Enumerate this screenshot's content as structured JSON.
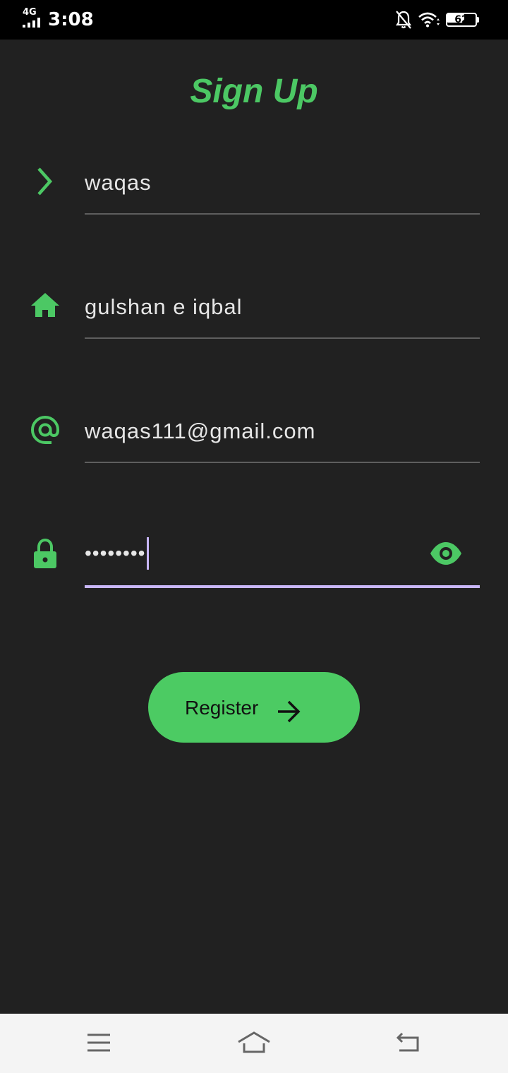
{
  "status_bar": {
    "network_type": "4G",
    "time": "3:08",
    "battery_level": "62",
    "icons": [
      "signal-bars-icon",
      "bell-off-icon",
      "wifi-icon",
      "battery-icon"
    ]
  },
  "page": {
    "title": "Sign Up"
  },
  "form": {
    "name": {
      "value": "waqas",
      "icon": "chevron-right-icon"
    },
    "address": {
      "value": "gulshan e iqbal",
      "icon": "home-icon"
    },
    "email": {
      "value": "waqas111@gmail.com",
      "icon": "at-sign-icon"
    },
    "password": {
      "value": "••••••••",
      "icon": "lock-icon",
      "toggle_icon": "eye-icon",
      "focused": true
    }
  },
  "register_button": {
    "label": "Register",
    "icon": "arrow-right-icon"
  },
  "nav_bar": {
    "buttons": [
      "menu-icon",
      "home-icon",
      "back-icon"
    ]
  },
  "colors": {
    "background": "#212121",
    "accent_green": "#4cc864",
    "button_green": "#4ccb63",
    "focus_purple": "#c8b6f8",
    "text": "#e6e6e6",
    "underline": "#5e5e5e"
  }
}
